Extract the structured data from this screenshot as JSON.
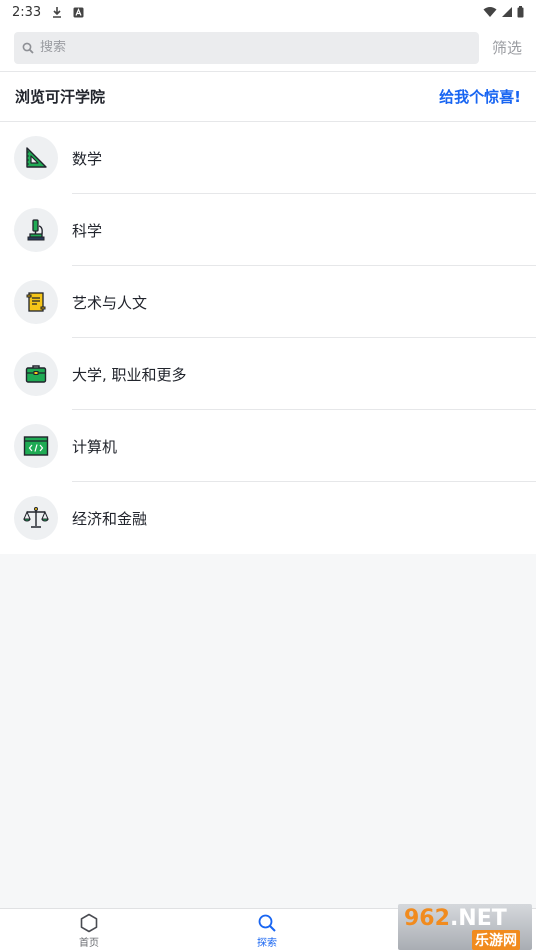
{
  "status_bar": {
    "time": "2:33",
    "icons": [
      "download-icon",
      "a-badge-icon",
      "wifi-icon",
      "signal-icon",
      "battery-icon"
    ]
  },
  "search": {
    "placeholder": "搜索",
    "filter_label": "筛选"
  },
  "browse": {
    "title": "浏览可汗学院",
    "surprise_label": "给我个惊喜!"
  },
  "subjects": [
    {
      "label": "数学",
      "icon": "ruler-triangle-icon"
    },
    {
      "label": "科学",
      "icon": "microscope-icon"
    },
    {
      "label": "艺术与人文",
      "icon": "scroll-icon"
    },
    {
      "label": "大学, 职业和更多",
      "icon": "briefcase-icon"
    },
    {
      "label": "计算机",
      "icon": "code-window-icon"
    },
    {
      "label": "经济和金融",
      "icon": "balance-scale-icon"
    }
  ],
  "bottom_nav": {
    "home_label": "首页",
    "explore_label": "探索",
    "active": "explore"
  },
  "watermark": {
    "brand_number": "962",
    "brand_suffix": ".NET",
    "brand_cn": "乐游网"
  },
  "colors": {
    "accent": "#1865f2",
    "icon_green": "#1fab54",
    "background": "#f6f7f8"
  }
}
